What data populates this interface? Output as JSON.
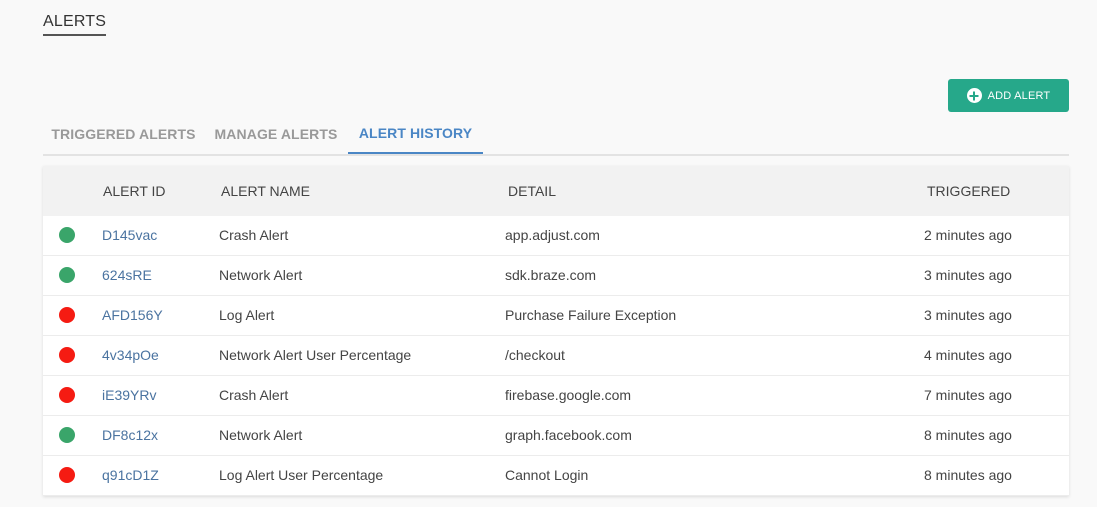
{
  "header": {
    "title": "ALERTS"
  },
  "actions": {
    "add_label": "ADD ALERT"
  },
  "tabs": [
    {
      "label": "TRIGGERED ALERTS"
    },
    {
      "label": "MANAGE ALERTS"
    },
    {
      "label": "ALERT HISTORY",
      "active": true
    }
  ],
  "table": {
    "columns": {
      "id": "ALERT ID",
      "name": "ALERT NAME",
      "detail": "DETAIL",
      "triggered": "TRIGGERED"
    },
    "rows": [
      {
        "status": "ok",
        "color": "#3aa56a",
        "id": "D145vac",
        "name": "Crash Alert",
        "detail": "app.adjust.com",
        "triggered": "2 minutes ago"
      },
      {
        "status": "ok",
        "color": "#3aa56a",
        "id": "624sRE",
        "name": "Network Alert",
        "detail": "sdk.braze.com",
        "triggered": "3 minutes ago"
      },
      {
        "status": "error",
        "color": "#f51b12",
        "id": "AFD156Y",
        "name": "Log Alert",
        "detail": "Purchase Failure Exception",
        "triggered": "3 minutes ago"
      },
      {
        "status": "error",
        "color": "#f51b12",
        "id": "4v34pOe",
        "name": "Network Alert User Percentage",
        "detail": "/checkout",
        "triggered": "4 minutes ago"
      },
      {
        "status": "error",
        "color": "#f51b12",
        "id": "iE39YRv",
        "name": "Crash Alert",
        "detail": "firebase.google.com",
        "triggered": "7 minutes ago"
      },
      {
        "status": "ok",
        "color": "#3aa56a",
        "id": "DF8c12x",
        "name": "Network Alert",
        "detail": "graph.facebook.com",
        "triggered": "8 minutes ago"
      },
      {
        "status": "error",
        "color": "#f51b12",
        "id": "q91cD1Z",
        "name": "Log Alert User Percentage",
        "detail": "Cannot Login",
        "triggered": "8 minutes ago"
      }
    ]
  },
  "colors": {
    "accent": "#26a88a",
    "active_tab": "#4a86c5",
    "link": "#4a73a0"
  }
}
